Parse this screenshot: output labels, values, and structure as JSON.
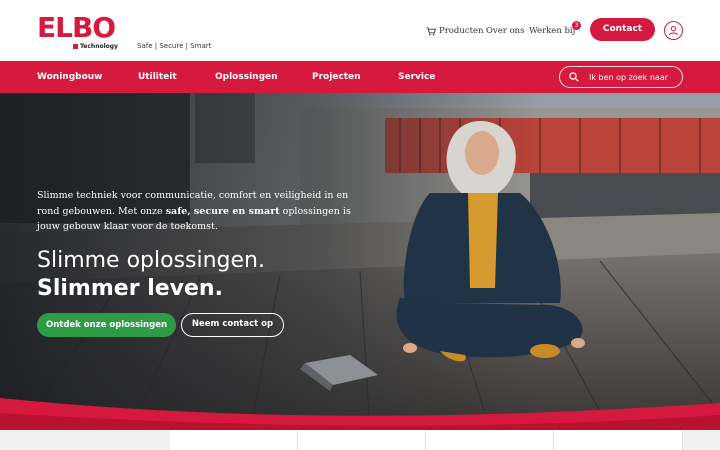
{
  "brand": {
    "logo_text": "ELBO",
    "logo_sub": "Technology",
    "tagline": "Safe | Secure | Smart",
    "accent": "#d6193f",
    "cta_green": "#2e9c45"
  },
  "topnav": {
    "products": "Producten",
    "products_icon": "cart-icon",
    "about": "Over ons",
    "work": "Werken bij",
    "work_badge": "3",
    "contact": "Contact",
    "user_icon": "user-icon"
  },
  "mainnav": {
    "items": [
      "Woningbouw",
      "Utiliteit",
      "Oplossingen",
      "Projecten",
      "Service"
    ],
    "search_placeholder": "Ik ben op zoek naar",
    "search_icon": "search-icon"
  },
  "hero": {
    "intro_part1": "Slimme techniek voor communicatie, comfort en veiligheid in en rond gebouwen. Met onze ",
    "intro_bold": "safe, secure en smart",
    "intro_part2": " oplossingen is jouw gebouw klaar voor de toekomst.",
    "heading_line1": "Slimme oplossingen.",
    "heading_line2": "Slimmer leven.",
    "cta_primary": "Ontdek onze oplossingen",
    "cta_secondary": "Neem contact op"
  }
}
